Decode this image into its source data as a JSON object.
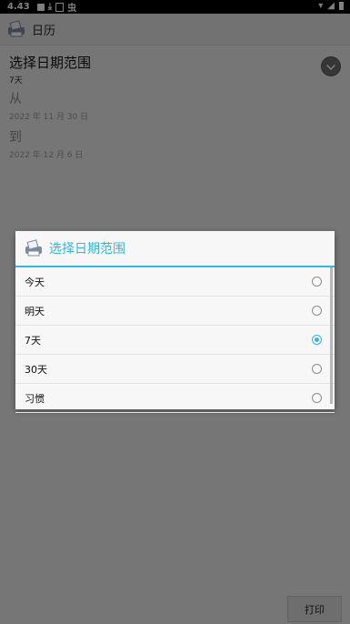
{
  "status_bar": {
    "time": "4.43",
    "icons": [
      "notification-icon",
      "download-icon",
      "sim-icon",
      "bug-icon"
    ],
    "right_icons": [
      "wifi-icon",
      "signal-icon",
      "battery-icon"
    ]
  },
  "app_bar": {
    "title": "日历"
  },
  "main": {
    "select_title": "选择日期范围",
    "select_value": "7天",
    "from_label": "从",
    "from_date": "2022 年 11 月 30 日",
    "to_label": "到",
    "to_date": "2022 年 12 月 6 日"
  },
  "print_label": "打印",
  "dialog": {
    "title": "选择日期范围",
    "accent_color": "#33b5e5",
    "options": [
      {
        "label": "今天",
        "selected": false
      },
      {
        "label": "明天",
        "selected": false
      },
      {
        "label": "7天",
        "selected": true
      },
      {
        "label": "30天",
        "selected": false
      },
      {
        "label": "习惯",
        "selected": false
      }
    ]
  }
}
